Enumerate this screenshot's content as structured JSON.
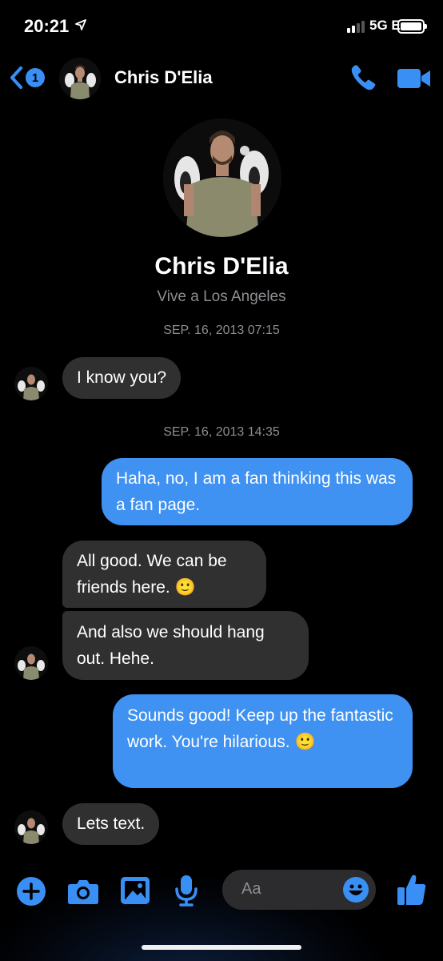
{
  "status_bar": {
    "time": "20:21",
    "network": "5G E"
  },
  "header": {
    "back_badge": "1",
    "contact_name": "Chris D'Elia"
  },
  "profile": {
    "name": "Chris D'Elia",
    "subtitle": "Vive a Los Angeles"
  },
  "conversation": {
    "timestamps": [
      "SEP. 16, 2013 07:15",
      "SEP. 16, 2013 14:35"
    ],
    "messages": [
      {
        "direction": "incoming",
        "text": "I know you?"
      },
      {
        "direction": "outgoing",
        "text": "Haha, no, I am a fan thinking this was a fan page."
      },
      {
        "direction": "incoming",
        "text": "All good. We can be friends here. 🙂"
      },
      {
        "direction": "incoming",
        "text": "And also we should hang out. Hehe."
      },
      {
        "direction": "outgoing",
        "text": "Sounds good! Keep up the fantastic work. You're hilarious. 🙂"
      },
      {
        "direction": "incoming",
        "text": "Lets text."
      }
    ]
  },
  "composer": {
    "placeholder": "Aa"
  },
  "colors": {
    "accent": "#3f91f2",
    "incoming_bubble": "#303030",
    "background": "#000000"
  },
  "icons": [
    "back-chevron-icon",
    "phone-icon",
    "video-camera-icon",
    "plus-icon",
    "camera-icon",
    "image-icon",
    "microphone-icon",
    "emoji-icon",
    "thumbs-up-icon"
  ]
}
